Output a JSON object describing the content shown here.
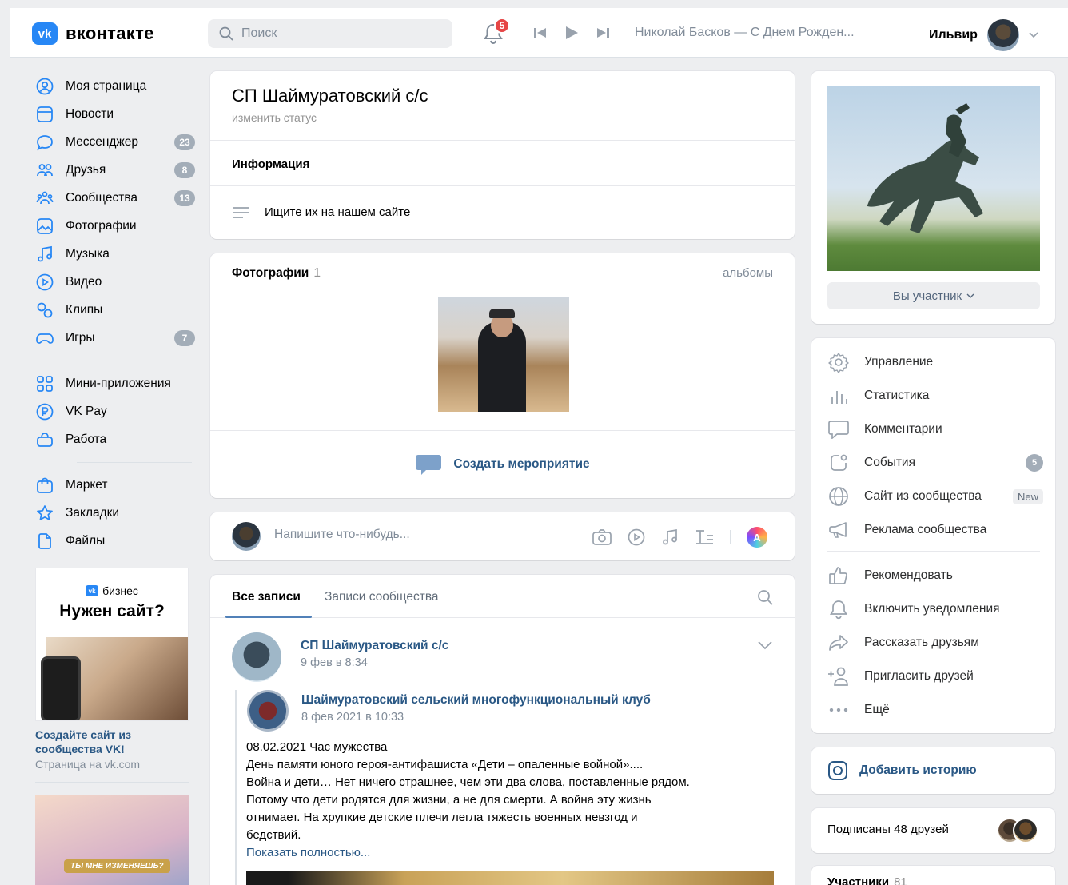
{
  "header": {
    "logo_text": "вконтакте",
    "logo_mark": "vk",
    "search_placeholder": "Поиск",
    "notifications_count": "5",
    "now_playing": "Николай Басков — С Днем Рожден...",
    "user_name": "Ильвир"
  },
  "sidebar": {
    "items": [
      {
        "label": "Моя страница",
        "icon": "user-circle-icon"
      },
      {
        "label": "Новости",
        "icon": "news-icon"
      },
      {
        "label": "Мессенджер",
        "icon": "chat-icon",
        "badge": "23"
      },
      {
        "label": "Друзья",
        "icon": "friends-icon",
        "badge": "8"
      },
      {
        "label": "Сообщества",
        "icon": "communities-icon",
        "badge": "13"
      },
      {
        "label": "Фотографии",
        "icon": "photo-icon"
      },
      {
        "label": "Музыка",
        "icon": "music-icon"
      },
      {
        "label": "Видео",
        "icon": "video-icon"
      },
      {
        "label": "Клипы",
        "icon": "clips-icon"
      },
      {
        "label": "Игры",
        "icon": "gamepad-icon",
        "badge": "7"
      }
    ],
    "items2": [
      {
        "label": "Мини-приложения",
        "icon": "apps-icon"
      },
      {
        "label": "VK Pay",
        "icon": "vkpay-icon"
      },
      {
        "label": "Работа",
        "icon": "briefcase-icon"
      }
    ],
    "items3": [
      {
        "label": "Маркет",
        "icon": "shopping-bag-icon"
      },
      {
        "label": "Закладки",
        "icon": "star-icon"
      },
      {
        "label": "Файлы",
        "icon": "file-icon"
      }
    ]
  },
  "ad": {
    "brand": "бизнес",
    "title": "Нужен сайт?",
    "caption": "Создайте сайт из сообщества VK!",
    "subcaption": "Страница на vk.com",
    "banner2": "ТЫ МНЕ ИЗМЕНЯЕШЬ?"
  },
  "community": {
    "title": "СП Шаймуратовский с/с",
    "status": "изменить статус",
    "info_heading": "Информация",
    "info_text": "Ищите их на нашем сайте"
  },
  "photos": {
    "heading": "Фотографии",
    "count": "1",
    "albums_link": "альбомы",
    "create_event": "Создать мероприятие"
  },
  "composer": {
    "placeholder": "Напишите что-нибудь...",
    "avatar_letter": "A"
  },
  "feed": {
    "tab_all": "Все записи",
    "tab_community": "Записи сообщества",
    "post": {
      "author": "СП Шаймуратовский с/с",
      "date": "9 фев в 8:34",
      "repost_author": "Шаймуратовский сельский многофункциональный клуб",
      "repost_date": "8 фев 2021 в 10:33",
      "text": [
        "08.02.2021 Час мужества",
        "День памяти юного героя-антифашиста «Дети – опаленные войной»....",
        "Война и дети… Нет ничего страшнее, чем эти два слова, поставленные рядом.",
        "Потому что дети родятся для жизни, а не для смерти. А война эту жизнь",
        "отнимает. На хрупкие детские плечи легла тяжесть военных невзгод и",
        "бедствий."
      ],
      "show_more": "Показать полностью..."
    }
  },
  "right": {
    "member_button": "Вы участник",
    "menu": [
      {
        "label": "Управление",
        "icon": "gear-icon"
      },
      {
        "label": "Статистика",
        "icon": "stats-icon"
      },
      {
        "label": "Комментарии",
        "icon": "comment-icon"
      },
      {
        "label": "События",
        "icon": "events-icon",
        "badge": "5"
      },
      {
        "label": "Сайт из сообщества",
        "icon": "globe-icon",
        "tag": "New"
      },
      {
        "label": "Реклама сообщества",
        "icon": "megaphone-icon"
      }
    ],
    "menu2": [
      {
        "label": "Рекомендовать",
        "icon": "thumbs-up-icon"
      },
      {
        "label": "Включить уведомления",
        "icon": "bell-icon"
      },
      {
        "label": "Рассказать друзьям",
        "icon": "share-icon"
      },
      {
        "label": "Пригласить друзей",
        "icon": "invite-icon"
      },
      {
        "label": "Ещё",
        "icon": "more-icon"
      }
    ],
    "add_story": "Добавить историю",
    "friends_subscribed": "Подписаны 48 друзей",
    "members_heading": "Участники",
    "members_count": "81"
  },
  "colors": {
    "accent": "#2787f5",
    "link": "#2a5885",
    "badge": "#a3adb8",
    "bg": "#edeef0"
  }
}
